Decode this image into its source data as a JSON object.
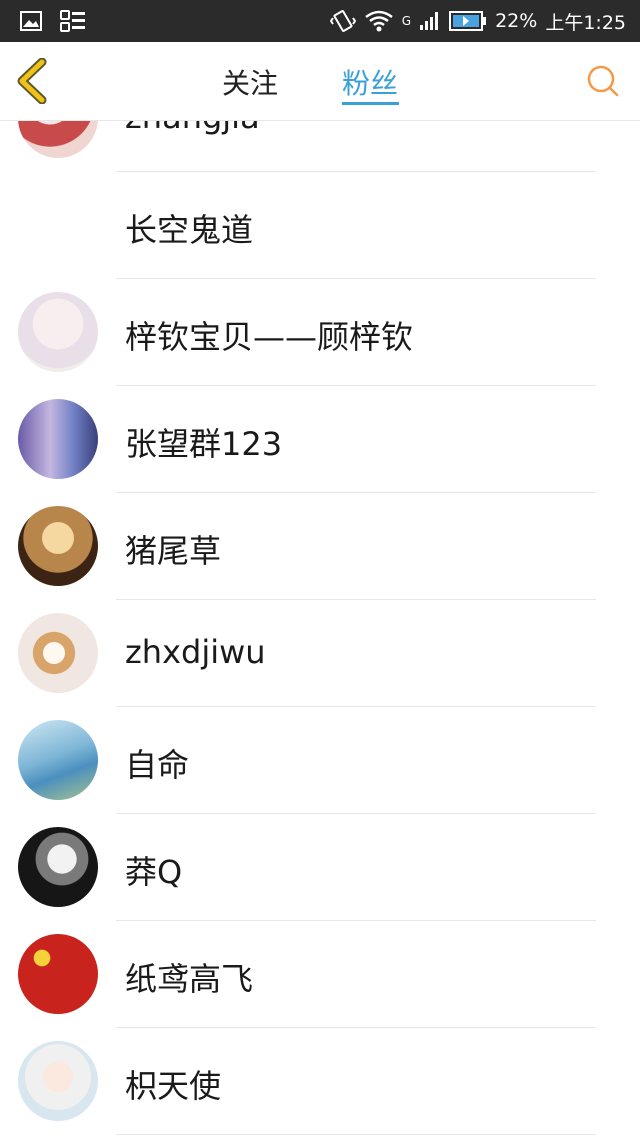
{
  "status_bar": {
    "carrier_network": "G",
    "battery_percent": "22%",
    "time": "上午1:25",
    "icons": [
      "gallery-icon",
      "app-notification-icon",
      "vibrate-icon",
      "wifi-icon",
      "signal-icon",
      "battery-icon"
    ]
  },
  "nav": {
    "back_icon": "chevron-left-icon",
    "tabs": [
      {
        "label": "关注",
        "active": false
      },
      {
        "label": "粉丝",
        "active": true
      }
    ],
    "search_icon": "search-icon",
    "accent_color": "#3aa0d8",
    "icon_color": "#f39a4a"
  },
  "followers": [
    {
      "name": "zhangjia"
    },
    {
      "name": "长空鬼道"
    },
    {
      "name": "梓钦宝贝——顾梓钦"
    },
    {
      "name": "张望群123"
    },
    {
      "name": "猪尾草"
    },
    {
      "name": "zhxdjiwu"
    },
    {
      "name": "自命"
    },
    {
      "name": "莽Q"
    },
    {
      "name": "纸鸢高飞"
    },
    {
      "name": "枳天使"
    }
  ]
}
